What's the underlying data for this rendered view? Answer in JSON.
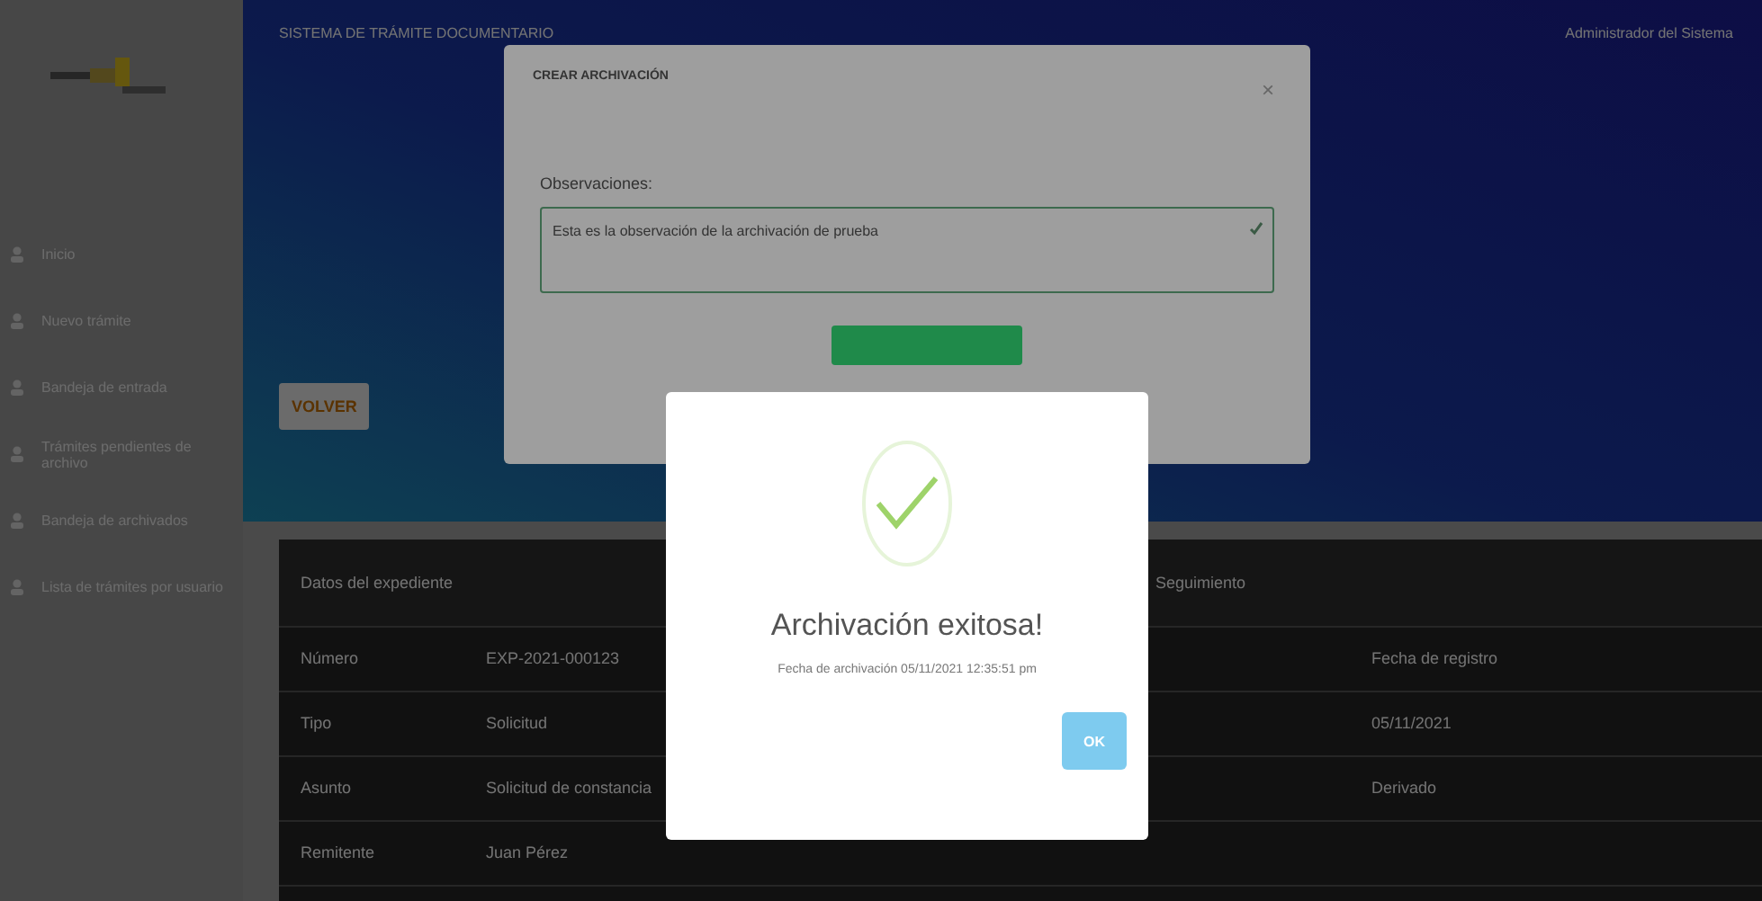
{
  "sidebar": {
    "items": [
      {
        "label": "Inicio",
        "selected": false
      },
      {
        "label": "Nuevo trámite",
        "selected": false
      },
      {
        "label": "Bandeja de entrada",
        "selected": false
      },
      {
        "label": "Trámites pendientes de archivo",
        "selected": false
      },
      {
        "label": "Bandeja de archivados",
        "selected": false
      },
      {
        "label": "Lista de trámites por usuario",
        "selected": false
      }
    ]
  },
  "header": {
    "title": "SISTEMA DE TRÁMITE DOCUMENTARIO",
    "user": "Administrador del Sistema",
    "back_button": "VOLVER"
  },
  "card": {
    "left_title": "Datos del expediente",
    "right_title": "Seguimiento",
    "rows": [
      {
        "label": "Número",
        "value": "EXP-2021-000123",
        "detail": "Fecha de registro"
      },
      {
        "label": "Tipo",
        "value": "Solicitud",
        "detail": "05/11/2021"
      },
      {
        "label": "Asunto",
        "value": "Solicitud de constancia",
        "detail": "Derivado"
      },
      {
        "label": "Remitente",
        "value": "Juan Pérez"
      }
    ]
  },
  "archive_modal": {
    "title": "CREAR ARCHIVACIÓN",
    "close": "×",
    "field_label": "Observaciones:",
    "field_value": "Esta es la observación de la archivación de prueba"
  },
  "success_dialog": {
    "title": "Archivación exitosa!",
    "message": "Fecha de archivación 05/11/2021 12:35:51 pm",
    "ok_button": "OK"
  }
}
